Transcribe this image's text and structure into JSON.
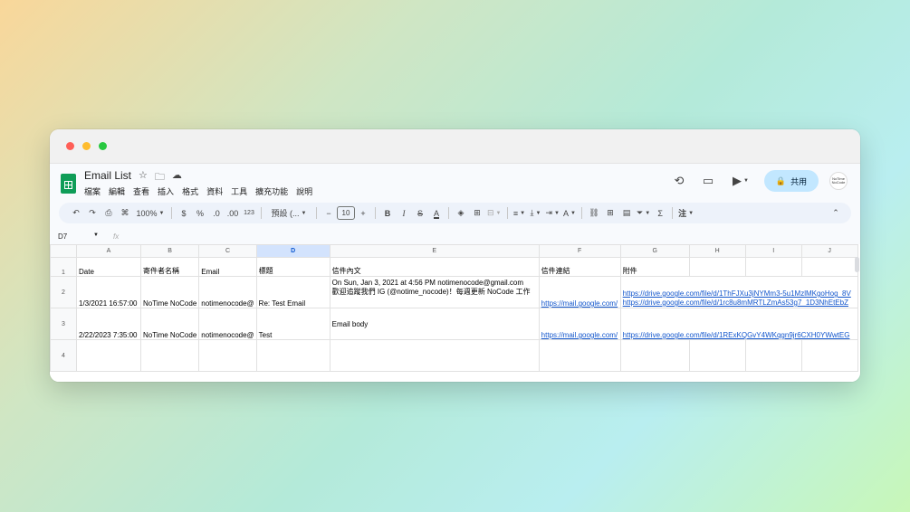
{
  "app": {
    "doc_title": "Email List",
    "menus": [
      "檔案",
      "編輯",
      "查看",
      "插入",
      "格式",
      "資料",
      "工具",
      "擴充功能",
      "說明"
    ],
    "share_label": "共用",
    "avatar_text": "NoTime NoCode"
  },
  "toolbar": {
    "zoom": "100%",
    "currency": "$",
    "percent": "%",
    "dec_decrease": ".0",
    "dec_increase": ".00",
    "number_format": "123",
    "font": "預設 (...",
    "font_size": "10",
    "functions_label": "注"
  },
  "formula_bar": {
    "cell_ref": "D7",
    "fx": "fx"
  },
  "sheet": {
    "columns": [
      "A",
      "B",
      "C",
      "D",
      "E",
      "F",
      "G",
      "H",
      "I",
      "J"
    ],
    "selected_column": "D",
    "row_numbers": [
      "1",
      "2",
      "3",
      "4"
    ],
    "header_row": [
      "Date",
      "寄件者名稱",
      "Email",
      "標題",
      "信件內文",
      "信件連結",
      "附件",
      "",
      "",
      ""
    ],
    "row2": {
      "date": "1/3/2021 16:57:00",
      "sender": "NoTime NoCode",
      "email": "notimenocode@",
      "subject": "Re: Test Email",
      "body_line1": "On Sun, Jan 3, 2021 at 4:56 PM notimenocode@gmail.com",
      "body_line2": "歡迎追蹤我們 IG (@notime_nocode)！每週更新 NoCode 工作",
      "link": "https://mail.google.com/",
      "attach_line1": "https://drive.google.com/file/d/1ThFJXu3jNYMm3-5u1MzlMKgoHog_8V",
      "attach_line2": "https://drive.google.com/file/d/1rc8u8mMRTLZmAs53g7_1D3NhEtEbZ"
    },
    "row3": {
      "date": "2/22/2023 7:35:00",
      "sender": "NoTime NoCode",
      "email": "notimenocode@",
      "subject": "Test",
      "body": "Email body",
      "link": "https://mail.google.com/",
      "attach": "https://drive.google.com/file/d/1RExKQGvY4WKqgn9jr6CXH0YWwtEG"
    }
  },
  "colors": {
    "share_bg": "#c2e7ff",
    "selected_header": "#d3e3fd",
    "link": "#1155cc",
    "sheets_green": "#0f9d58"
  }
}
